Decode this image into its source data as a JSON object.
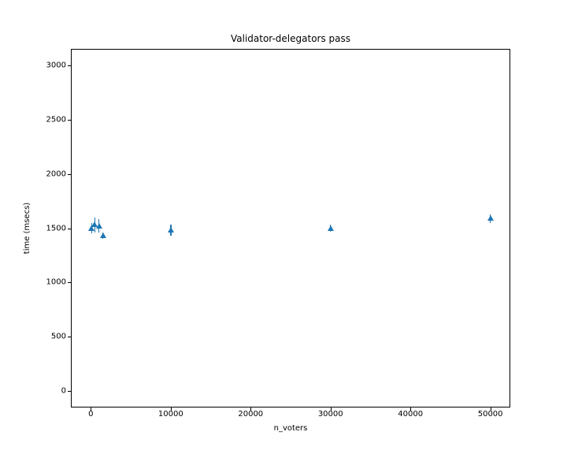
{
  "chart_data": {
    "type": "scatter",
    "title": "Validator-delegators pass",
    "xlabel": "n_voters",
    "ylabel": "time (msecs)",
    "xlim": [
      -2500,
      52500
    ],
    "ylim": [
      -150,
      3150
    ],
    "xticks": [
      0,
      10000,
      20000,
      30000,
      40000,
      50000
    ],
    "yticks": [
      0,
      500,
      1000,
      1500,
      2000,
      2500,
      3000
    ],
    "series": [
      {
        "name": "time",
        "points": [
          {
            "x": 100,
            "y": 1500,
            "err": 50
          },
          {
            "x": 500,
            "y": 1530,
            "err": 70
          },
          {
            "x": 1000,
            "y": 1520,
            "err": 60
          },
          {
            "x": 1500,
            "y": 1430,
            "err": 30
          },
          {
            "x": 10000,
            "y": 1480,
            "err": 50
          },
          {
            "x": 30000,
            "y": 1500,
            "err": 30
          },
          {
            "x": 50000,
            "y": 1590,
            "err": 40
          }
        ]
      }
    ]
  }
}
